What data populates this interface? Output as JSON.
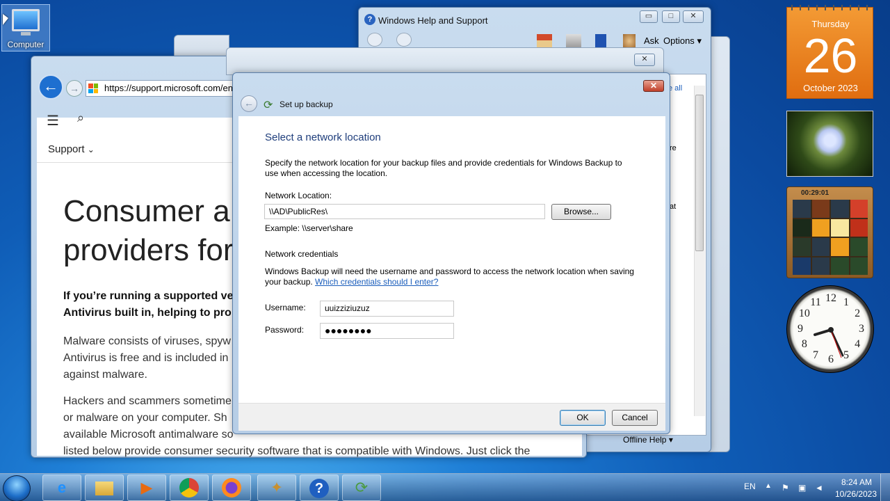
{
  "desktop": {
    "icon_label": "Computer"
  },
  "browser": {
    "address": "https://support.microsoft.com/en",
    "nav_label": "Support",
    "hero_title": "Consumer a\nproviders for",
    "para_bold": "If you’re running a supported ve\nAntivirus built in, helping to pro",
    "para_2": "Malware consists of viruses, spyw\nAntivirus is free and is included in\nagainst malware.",
    "para_3": "Hackers and scammers sometime\nor malware on your computer. Sh\navailable Microsoft antimalware so\nlisted below provide consumer security software that is compatible with Windows. Just click the"
  },
  "help": {
    "title": "Windows Help and Support",
    "ask": "Ask",
    "options": "Options",
    "see_all": "e all",
    "frag_re": "re",
    "frag_at": "at",
    "offline": "Offline Help"
  },
  "dialog": {
    "title": "Set up backup",
    "heading": "Select a network location",
    "description": "Specify the network location for your backup files and provide credentials for Windows Backup to use when accessing the location.",
    "network_location_label": "Network Location:",
    "network_location_value": "\\\\AD\\PublicRes\\",
    "browse_label": "Browse...",
    "example": "Example: \\\\server\\share",
    "credentials_heading": "Network credentials",
    "credentials_desc": "Windows Backup will need the username and password to access the network location when saving your backup. ",
    "credentials_link": "Which credentials should I enter?",
    "username_label": "Username:",
    "username_value": "uuizziziuzuz",
    "password_label": "Password:",
    "password_value": "●●●●●●●●",
    "ok_label": "OK",
    "cancel_label": "Cancel"
  },
  "gadgets": {
    "calendar": {
      "day": "Thursday",
      "date": "26",
      "month_year": "October 2023"
    },
    "puzzle_time": "00:29:01",
    "clock_numbers": [
      "12",
      "1",
      "2",
      "3",
      "4",
      "5",
      "6",
      "7",
      "8",
      "9",
      "10",
      "11"
    ]
  },
  "taskbar": {
    "apps": [
      "ie-icon",
      "explorer-icon",
      "media-player-icon",
      "chrome-icon",
      "firefox-icon",
      "sync-icon",
      "help-icon",
      "backup-icon"
    ],
    "lang": "EN",
    "time": "8:24 AM",
    "date": "10/26/2023"
  }
}
